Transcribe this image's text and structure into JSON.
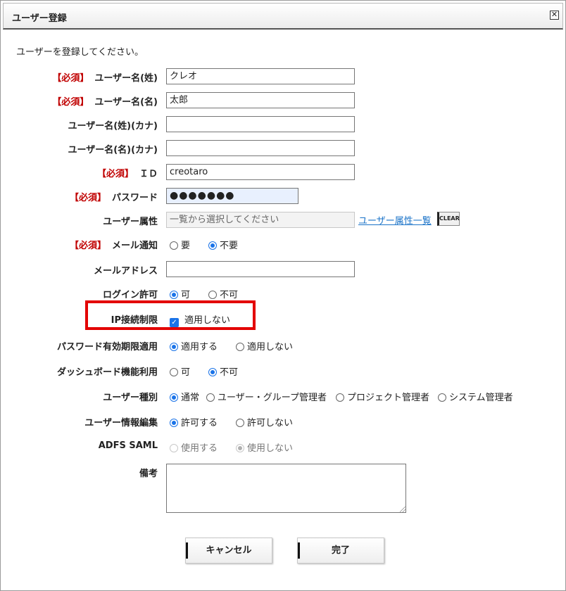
{
  "dialog": {
    "title": "ユーザー登録",
    "close_icon": "close-icon",
    "intro": "ユーザーを登録してください。"
  },
  "required_tag": "【必須】",
  "fields": {
    "last_name": {
      "label": "ユーザー名(姓)",
      "value": "クレオ"
    },
    "first_name": {
      "label": "ユーザー名(名)",
      "value": "太郎"
    },
    "last_name_kana": {
      "label": "ユーザー名(姓)(カナ)",
      "value": ""
    },
    "first_name_kana": {
      "label": "ユーザー名(名)(カナ)",
      "value": ""
    },
    "id": {
      "label": "ＩＤ",
      "value": "creotaro"
    },
    "password": {
      "label": "パスワード",
      "value": "●●●●●●●"
    },
    "attribute": {
      "label": "ユーザー属性",
      "placeholder": "一覧から選択してください",
      "link": "ユーザー属性一覧",
      "clear": "CLEAR"
    },
    "mail_notify": {
      "label": "メール通知",
      "options": [
        "要",
        "不要"
      ],
      "selected": "不要"
    },
    "mail_address": {
      "label": "メールアドレス",
      "value": ""
    },
    "login": {
      "label": "ログイン許可",
      "options": [
        "可",
        "不可"
      ],
      "selected": "可"
    },
    "ip_limit": {
      "label": "IP接続制限",
      "checkbox_label": "適用しない",
      "checked": true
    },
    "pw_expiry": {
      "label": "パスワード有効期限適用",
      "options": [
        "適用する",
        "適用しない"
      ],
      "selected": "適用する"
    },
    "dashboard": {
      "label": "ダッシュボード機能利用",
      "options": [
        "可",
        "不可"
      ],
      "selected": "不可"
    },
    "user_type": {
      "label": "ユーザー種別",
      "options": [
        "通常",
        "ユーザー・グループ管理者",
        "プロジェクト管理者",
        "システム管理者"
      ],
      "selected": "通常"
    },
    "info_edit": {
      "label": "ユーザー情報編集",
      "options": [
        "許可する",
        "許可しない"
      ],
      "selected": "許可する"
    },
    "adfs": {
      "label": "ADFS SAML",
      "options": [
        "使用する",
        "使用しない"
      ],
      "selected": "使用しない",
      "disabled": true
    },
    "notes": {
      "label": "備考",
      "value": ""
    }
  },
  "buttons": {
    "cancel": "キャンセル",
    "done": "完了"
  },
  "colors": {
    "required": "#c00000",
    "highlight": "#e30000",
    "accent": "#1a73e8",
    "link": "#1a73c8"
  }
}
